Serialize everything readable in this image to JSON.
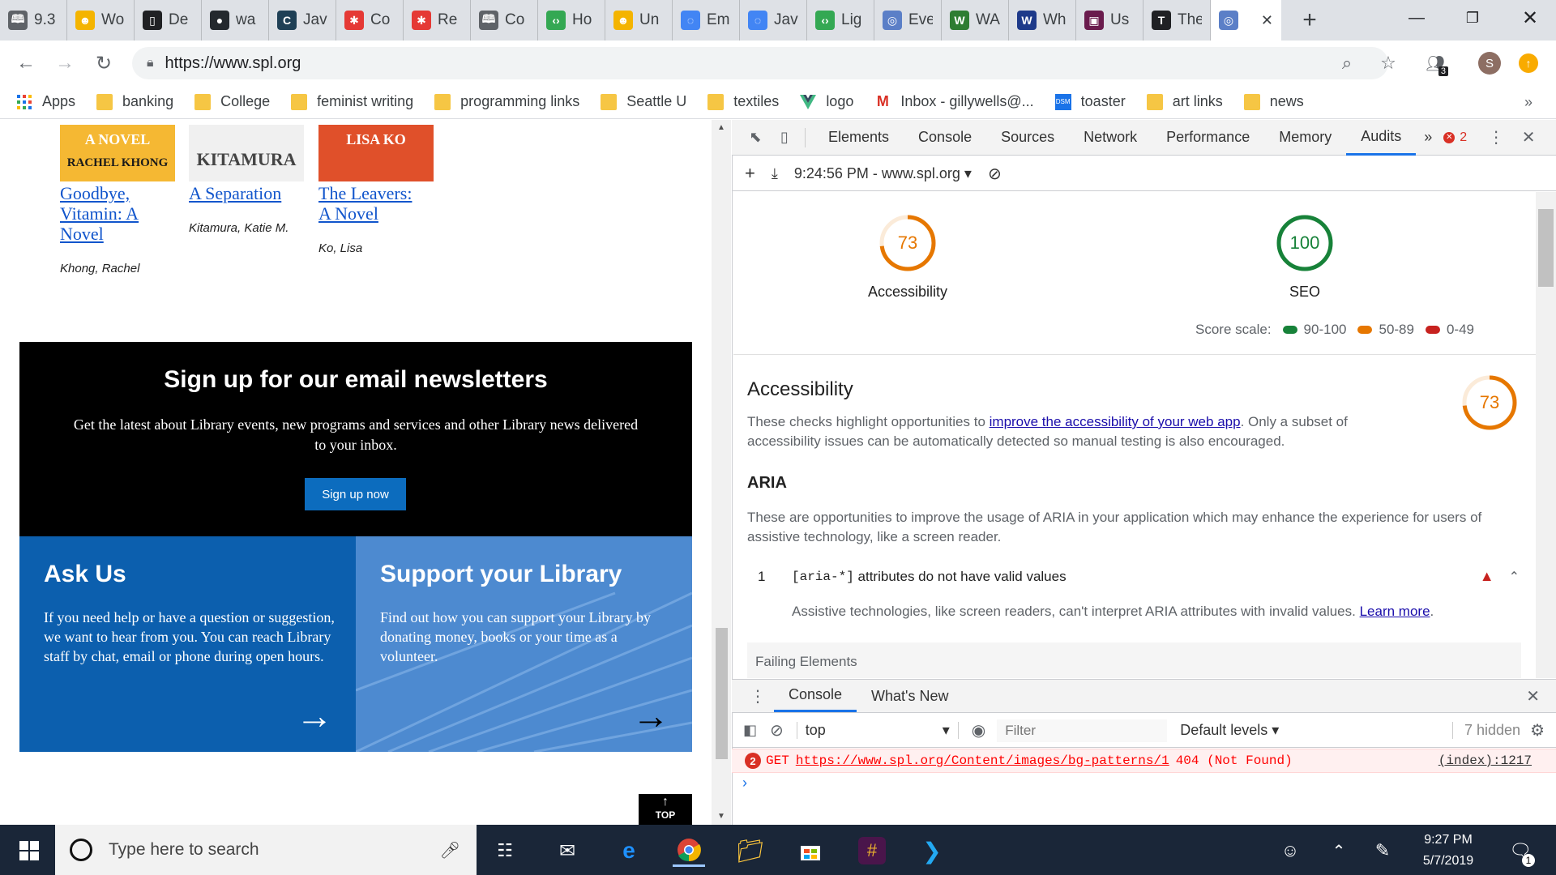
{
  "browser": {
    "tabs": [
      {
        "title": "9.3",
        "icon": "book-icon",
        "color": "#5f6368"
      },
      {
        "title": "Wo",
        "icon": "smiley-icon",
        "color": "#f4b400"
      },
      {
        "title": "De",
        "icon": "devices-icon",
        "color": "#202124"
      },
      {
        "title": "wa",
        "icon": "github-icon",
        "color": "#24292e"
      },
      {
        "title": "Jav",
        "icon": "codecademy-icon",
        "color": "#1f4056"
      },
      {
        "title": "Co",
        "icon": "redwheel-icon",
        "color": "#e53935"
      },
      {
        "title": "Re",
        "icon": "redwheel-icon",
        "color": "#e53935"
      },
      {
        "title": "Co",
        "icon": "book-icon",
        "color": "#5f6368"
      },
      {
        "title": "Ho",
        "icon": "code-icon",
        "color": "#34a853"
      },
      {
        "title": "Un",
        "icon": "smiley-icon",
        "color": "#f4b400"
      },
      {
        "title": "Em",
        "icon": "swirl-icon",
        "color": "#4285f4"
      },
      {
        "title": "Jav",
        "icon": "swirl-icon",
        "color": "#4285f4"
      },
      {
        "title": "Lig",
        "icon": "code-icon",
        "color": "#34a853"
      },
      {
        "title": "Eve",
        "icon": "globe-icon",
        "color": "#5b7fc7"
      },
      {
        "title": "WA",
        "icon": "w-circle-icon",
        "color": "#2e7d32"
      },
      {
        "title": "Wh",
        "icon": "w-bars-icon",
        "color": "#1e3a8a"
      },
      {
        "title": "Us",
        "icon": "image-icon",
        "color": "#6a1b4d"
      },
      {
        "title": "The",
        "icon": "serif-icon",
        "color": "#202124"
      }
    ],
    "active_tab_icon": "globe-icon",
    "new_tab": "+",
    "url": "https://www.spl.org",
    "extension_badge": "3",
    "profile_initial": "S"
  },
  "bookmarks": [
    {
      "label": "Apps",
      "icon": "apps-grid-icon"
    },
    {
      "label": "banking",
      "icon": "folder-icon"
    },
    {
      "label": "College",
      "icon": "folder-icon"
    },
    {
      "label": "feminist writing",
      "icon": "folder-icon"
    },
    {
      "label": "programming links",
      "icon": "folder-icon"
    },
    {
      "label": "Seattle U",
      "icon": "folder-icon"
    },
    {
      "label": "textiles",
      "icon": "folder-icon"
    },
    {
      "label": "logo",
      "icon": "vue-icon"
    },
    {
      "label": "Inbox - gillywells@...",
      "icon": "gmail-icon"
    },
    {
      "label": "toaster",
      "icon": "dsm-icon"
    },
    {
      "label": "art links",
      "icon": "folder-icon"
    },
    {
      "label": "news",
      "icon": "folder-icon"
    }
  ],
  "page": {
    "books": [
      {
        "cover_text": "A NOVEL",
        "cover_text2": "RACHEL KHONG",
        "title_lines": [
          "Goodbye,",
          "Vitamin: A",
          "Novel"
        ],
        "author": "Khong, Rachel",
        "cover_color": "#f5b833"
      },
      {
        "cover_text": "KITAMURA",
        "cover_text2": "",
        "title_lines": [
          "A Separation"
        ],
        "author": "Kitamura, Katie M.",
        "cover_color": "#f0f0f0"
      },
      {
        "cover_text": "LISA KO",
        "cover_text2": "",
        "title_lines": [
          "The Leavers:",
          "A Novel"
        ],
        "author": "Ko, Lisa",
        "cover_color": "#e0502a"
      }
    ],
    "newsletter": {
      "title": "Sign up for our email newsletters",
      "description": "Get the latest about Library events, new programs and services and other Library news delivered to your inbox.",
      "button": "Sign up now"
    },
    "ask_us": {
      "title": "Ask Us",
      "description": "If you need help or have a question or suggestion, we want to hear from you. You can reach Library staff by chat, email or phone during open hours.",
      "arrow": "→"
    },
    "support": {
      "title": "Support your Library",
      "description": "Find out how you can support your Library by donating money, books or your time as a volunteer.",
      "arrow": "→"
    },
    "top_button": "TOP"
  },
  "devtools": {
    "tabs": [
      "Elements",
      "Console",
      "Sources",
      "Network",
      "Performance",
      "Memory",
      "Audits"
    ],
    "active_tab": "Audits",
    "more": "»",
    "error_count": "2",
    "report_label": "9:24:56 PM - www.spl.org",
    "scores": [
      {
        "label": "Accessibility",
        "value": 73,
        "color": "#e67700"
      },
      {
        "label": "SEO",
        "value": 100,
        "color": "#178239"
      }
    ],
    "score_scale": {
      "label": "Score scale:",
      "ranges": [
        {
          "text": "90-100",
          "color": "#178239"
        },
        {
          "text": "50-89",
          "color": "#e67700"
        },
        {
          "text": "0-49",
          "color": "#c7221f"
        }
      ]
    },
    "accessibility": {
      "heading": "Accessibility",
      "score": 73,
      "desc_before": "These checks highlight opportunities to ",
      "desc_link": "improve the accessibility of your web app",
      "desc_after": ". Only a subset of accessibility issues can be automatically detected so manual testing is also encouraged."
    },
    "aria": {
      "heading": "ARIA",
      "description": "These are opportunities to improve the usage of ARIA in your application which may enhance the experience for users of assistive technology, like a screen reader.",
      "item_index": "1",
      "item_code": "[aria-*]",
      "item_text": " attributes do not have valid values",
      "item_desc": "Assistive technologies, like screen readers, can't interpret ARIA attributes with invalid values. ",
      "item_link": "Learn more",
      "failing": "Failing Elements"
    },
    "drawer": {
      "tabs": [
        "Console",
        "What's New"
      ],
      "context": "top",
      "filter_placeholder": "Filter",
      "levels": "Default levels",
      "hidden": "7 hidden",
      "error": {
        "count": "2",
        "method": "GET",
        "url": "https://www.spl.org/Content/images/bg-patterns/1",
        "status": "404 (Not Found)",
        "source": "(index):1217"
      },
      "prompt": "›"
    }
  },
  "taskbar": {
    "search_placeholder": "Type here to search",
    "time": "9:27 PM",
    "date": "5/7/2019",
    "notification_count": "1"
  }
}
